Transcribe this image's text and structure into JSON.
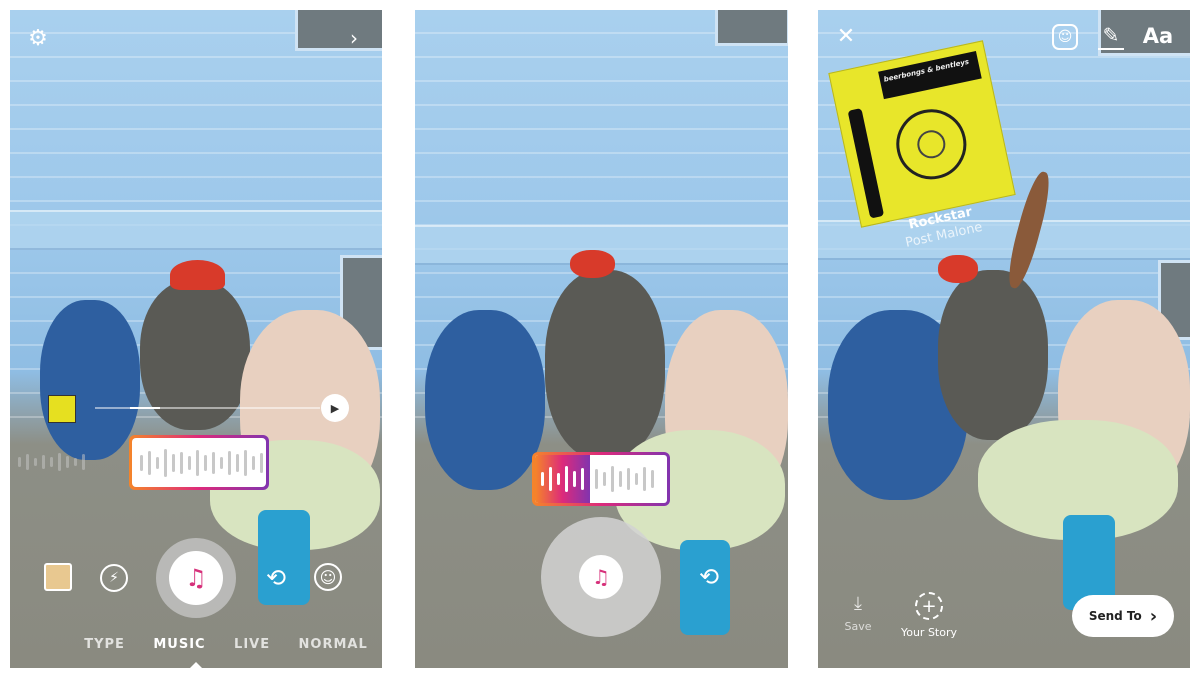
{
  "panel1": {
    "modes": [
      "TYPE",
      "MUSIC",
      "LIVE",
      "NORMAL"
    ],
    "active_mode": "MUSIC",
    "icons": [
      "settings-icon",
      "chevron-right-icon",
      "album-thumbnail",
      "play-icon",
      "gallery-thumbnail",
      "flash-icon",
      "music-note-icon",
      "flip-camera-icon",
      "face-effects-icon"
    ]
  },
  "panel2": {
    "icons": [
      "music-note-icon",
      "flip-camera-icon"
    ]
  },
  "panel3": {
    "song_title": "Rockstar",
    "artist": "Post Malone",
    "album_art_text": "beerbongs & bentleys",
    "save_label": "Save",
    "your_story_label": "Your Story",
    "send_to_label": "Send To",
    "text_tool_label": "Aa",
    "icons": [
      "close-icon",
      "sticker-icon",
      "draw-icon",
      "download-icon",
      "add-story-icon",
      "chevron-right-icon"
    ]
  },
  "colors": {
    "gradient_start": "#f58529",
    "gradient_mid": "#dd2a7b",
    "gradient_end": "#8134af"
  }
}
